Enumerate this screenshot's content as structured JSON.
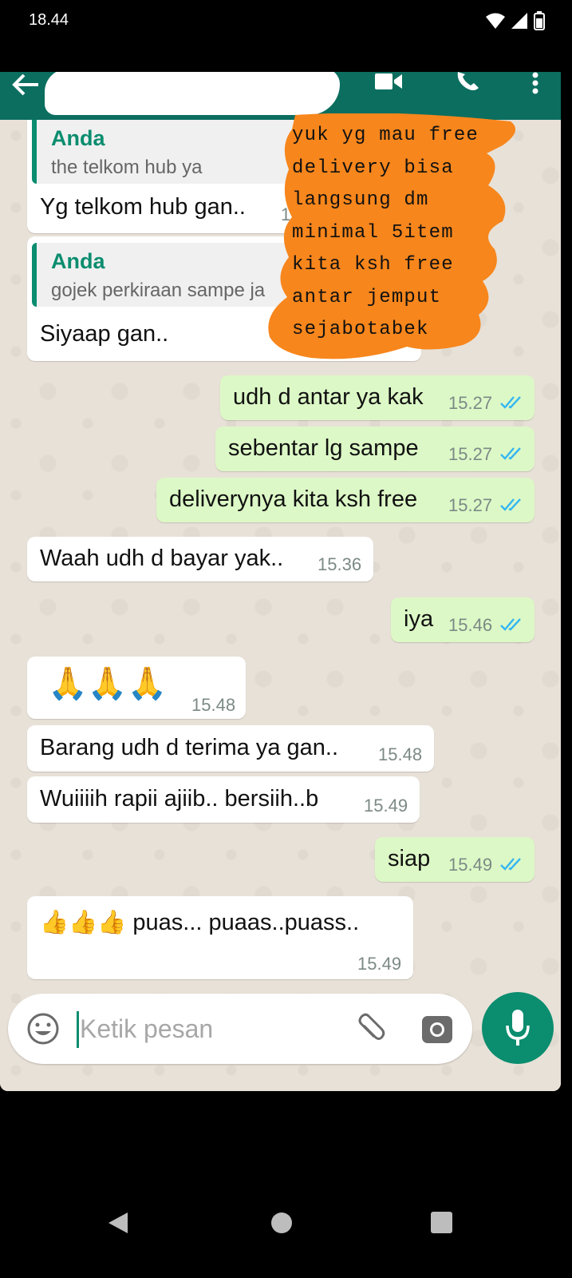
{
  "status_bar": {
    "time": "18.44"
  },
  "chat": {
    "messages": [
      {
        "direction": "in",
        "reply_author": "Anda",
        "reply_text": "the telkom hub ya",
        "text": "Yg telkom hub gan..",
        "time": "1"
      },
      {
        "direction": "in",
        "reply_author": "Anda",
        "reply_text": "gojek perkiraan sampe ja",
        "text": "Siyaap gan..",
        "time": ""
      },
      {
        "direction": "out",
        "text": "udh d antar ya kak",
        "time": "15.27",
        "status": "read"
      },
      {
        "direction": "out",
        "text": "sebentar lg sampe",
        "time": "15.27",
        "status": "read"
      },
      {
        "direction": "out",
        "text": "deliverynya kita ksh free",
        "time": "15.27",
        "status": "read"
      },
      {
        "direction": "in",
        "text": "Waah udh d bayar yak..",
        "time": "15.36"
      },
      {
        "direction": "out",
        "text": "iya",
        "time": "15.46",
        "status": "read"
      },
      {
        "direction": "in",
        "text": "🙏🙏🙏",
        "time": "15.48"
      },
      {
        "direction": "in",
        "text": "Barang udh d terima ya gan..",
        "time": "15.48"
      },
      {
        "direction": "in",
        "text": "Wuiiiih rapii ajiib.. bersiih..b",
        "time": "15.49"
      },
      {
        "direction": "out",
        "text": "siap",
        "time": "15.49",
        "status": "read"
      },
      {
        "direction": "in",
        "text": "👍👍👍 puas... puaas..puass..",
        "time": "15.49"
      }
    ]
  },
  "overlay_note": "yuk yg mau free\ndelivery bisa\nlangsung dm\nminimal 5item\nkita ksh free\nantar jemput\nsejabotabek",
  "composer": {
    "placeholder": "Ketik pesan"
  },
  "icons": [
    "back-icon",
    "video-call-icon",
    "voice-call-icon",
    "more-options-icon",
    "emoji-icon",
    "attach-icon",
    "camera-icon",
    "mic-icon",
    "read-ticks-icon"
  ],
  "colors": {
    "header": "#0b6e5f",
    "accent": "#0b8d6f",
    "outgoing_bubble": "#dcf8c6",
    "incoming_bubble": "#ffffff",
    "ticks": "#34b7f1",
    "overlay": "#f7861c"
  }
}
